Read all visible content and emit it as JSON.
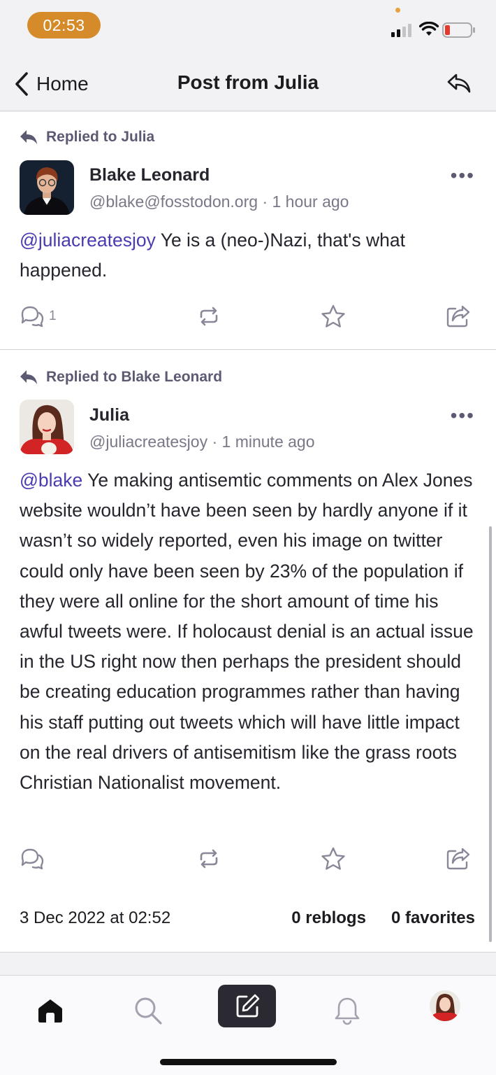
{
  "status_bar": {
    "time": "02:53"
  },
  "nav": {
    "back_label": "Home",
    "title": "Post from Julia"
  },
  "posts": [
    {
      "replied_to": "Replied to Julia",
      "author": "Blake Leonard",
      "handle_time": "@blake@fosstodon.org · 1 hour ago",
      "mention": "@juliacreatesjoy",
      "text": " Ye is a (neo-)Nazi, that's what happened.",
      "reply_count": "1"
    },
    {
      "replied_to": "Replied to Blake Leonard",
      "author": "Julia",
      "handle_time": "@juliacreatesjoy · 1 minute ago",
      "mention": "@blake",
      "text": " Ye making antisemtic comments on Alex Jones website wouldn’t have been seen by hardly anyone if it wasn’t so widely reported, even his image on twitter could only have been seen by 23% of the population if they were all online for the short amount of time his awful tweets were. If holocaust denial is an actual issue in the US right now then perhaps the president should be creating education programmes rather than having his staff putting out tweets which will have little impact on the real drivers of antisemitism like the grass roots Christian Nationalist movement.",
      "date": "3 Dec 2022 at 02:52",
      "reblogs": "0 reblogs",
      "favorites": "0 favorites"
    }
  ],
  "icons": {
    "back": "chevron-left-icon",
    "nav_reply": "reply-icon",
    "replied": "reply-arrow-icon",
    "more": "ellipsis-icon",
    "reply": "speech-bubbles-icon",
    "boost": "repeat-icon",
    "favorite": "star-icon",
    "share": "share-icon",
    "tabs": [
      "home-icon",
      "search-icon",
      "compose-icon",
      "bell-icon",
      "profile-avatar"
    ]
  },
  "colors": {
    "mention": "#4a3cb0",
    "status_pill": "#d68b2b",
    "compose_bg": "#2b2a33"
  }
}
